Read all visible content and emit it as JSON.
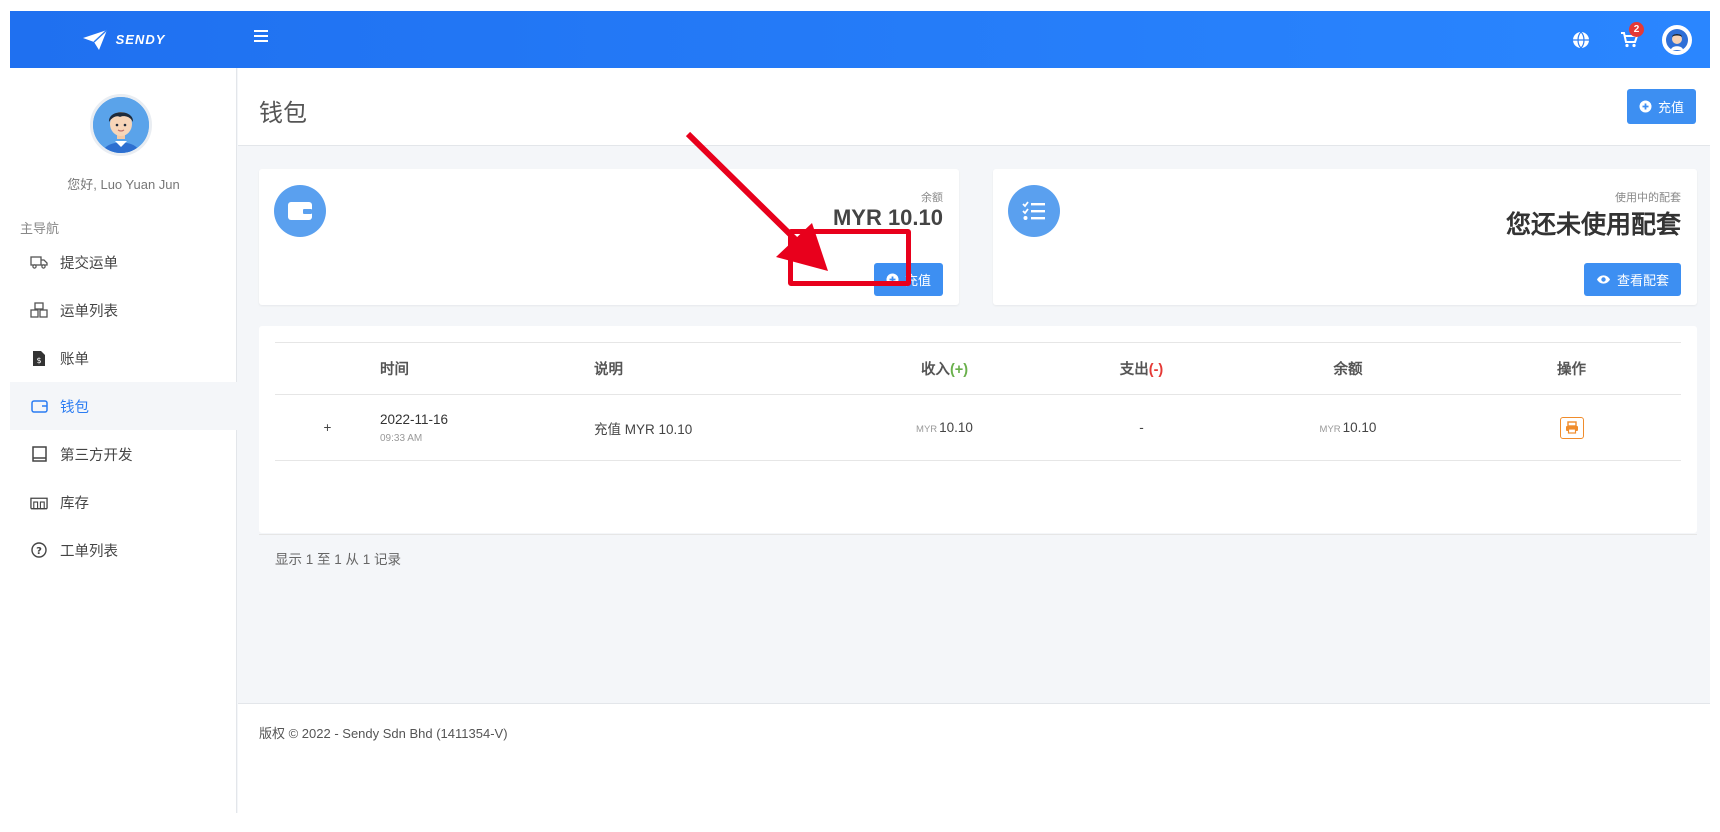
{
  "header": {
    "brand": "SENDY",
    "cart_count": "2"
  },
  "sidebar": {
    "greeting": "您好, Luo Yuan Jun",
    "nav_title": "主导航",
    "items": [
      {
        "label": "提交运单",
        "icon": "truck-icon"
      },
      {
        "label": "运单列表",
        "icon": "boxes-icon"
      },
      {
        "label": "账单",
        "icon": "invoice-icon"
      },
      {
        "label": "钱包",
        "icon": "wallet-icon",
        "active": true
      },
      {
        "label": "第三方开发",
        "icon": "book-icon"
      },
      {
        "label": "库存",
        "icon": "warehouse-icon"
      },
      {
        "label": "工单列表",
        "icon": "question-icon"
      }
    ]
  },
  "page": {
    "title": "钱包",
    "topup_label": "充值"
  },
  "balance_card": {
    "label": "余额",
    "value": "MYR 10.10",
    "button_label": "充值"
  },
  "package_card": {
    "label": "使用中的配套",
    "value": "您还未使用配套",
    "button_label": "查看配套"
  },
  "table": {
    "headers": {
      "time": "时间",
      "description": "说明",
      "income": "收入",
      "income_sign": "(+)",
      "expense": "支出",
      "expense_sign": "(-)",
      "balance": "余额",
      "action": "操作"
    },
    "rows": [
      {
        "expand": "+",
        "date": "2022-11-16",
        "time": "09:33 AM",
        "desc_prefix": "充值",
        "desc_amount": "MYR 10.10",
        "income_unit": "MYR",
        "income": "10.10",
        "expense": "-",
        "balance_unit": "MYR",
        "balance": "10.10"
      }
    ],
    "records_info": "显示 1 至 1 从 1 记录"
  },
  "footer": {
    "copyright": "版权 © 2022 - Sendy Sdn Bhd (1411354-V)"
  },
  "colors": {
    "header_blue": "#1f70f0",
    "button_blue": "#3d8ff2",
    "highlight_red": "#e8001c",
    "print_orange": "#f08c2b"
  }
}
